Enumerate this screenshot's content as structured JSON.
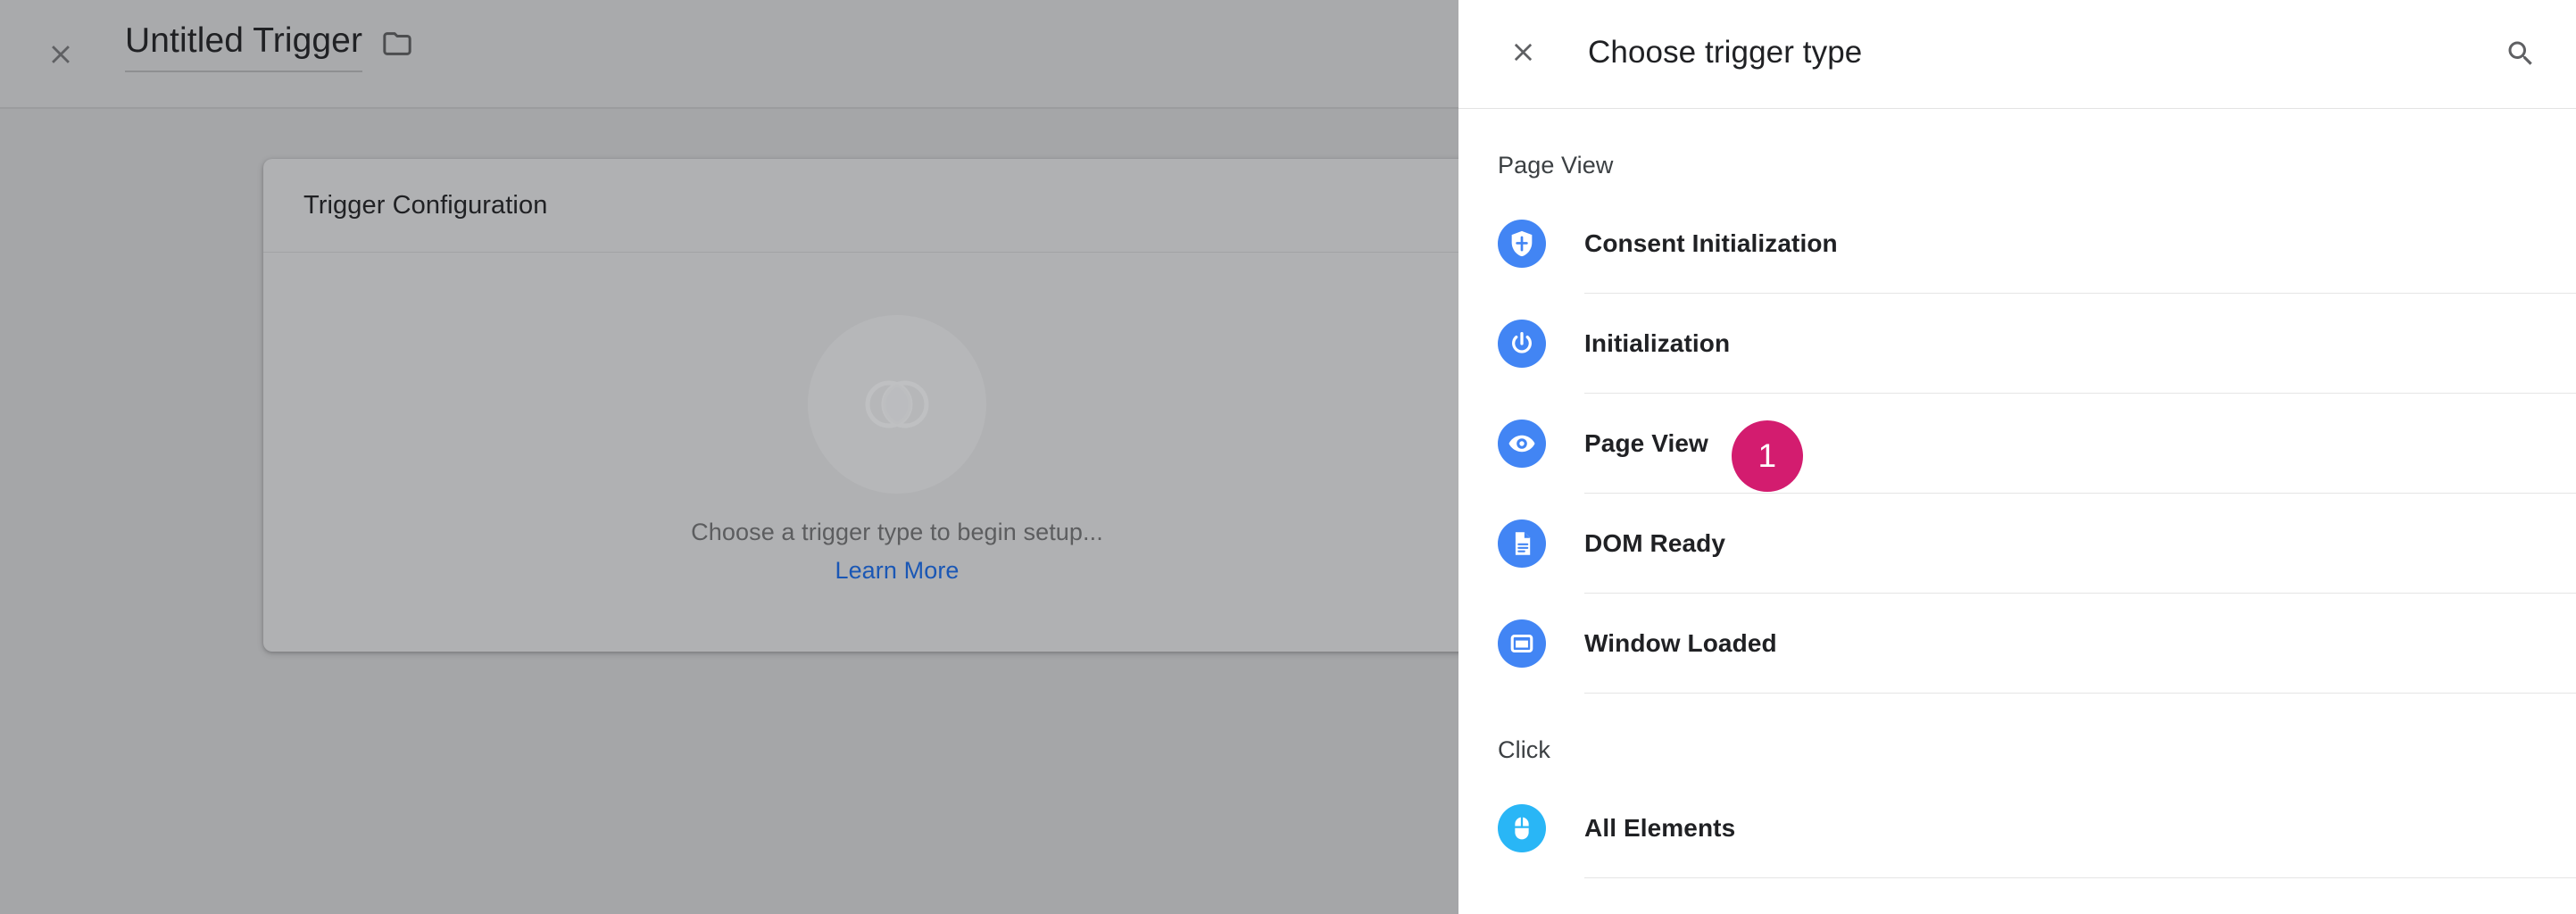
{
  "editor": {
    "close_icon": "close-icon",
    "trigger_name": "Untitled Trigger",
    "folder_icon": "folder-icon",
    "card": {
      "title": "Trigger Configuration",
      "placeholder_icon": "trigger-overlap-circles-icon",
      "placeholder_text": "Choose a trigger type to begin setup...",
      "learn_more_label": "Learn More"
    }
  },
  "panel": {
    "close_icon": "close-icon",
    "title": "Choose trigger type",
    "search_icon": "search-icon",
    "badge": {
      "value": "1",
      "color": "#d31c6f"
    },
    "sections": [
      {
        "header": "Page View",
        "items": [
          {
            "label": "Consent Initialization",
            "icon": "shield-icon",
            "icon_color": "#4285f4"
          },
          {
            "label": "Initialization",
            "icon": "power-icon",
            "icon_color": "#4285f4"
          },
          {
            "label": "Page View",
            "icon": "eye-icon",
            "icon_color": "#4285f4"
          },
          {
            "label": "DOM Ready",
            "icon": "document-icon",
            "icon_color": "#4285f4"
          },
          {
            "label": "Window Loaded",
            "icon": "window-icon",
            "icon_color": "#4285f4"
          }
        ]
      },
      {
        "header": "Click",
        "items": [
          {
            "label": "All Elements",
            "icon": "mouse-icon",
            "icon_color": "#29b6f6"
          }
        ]
      }
    ]
  }
}
